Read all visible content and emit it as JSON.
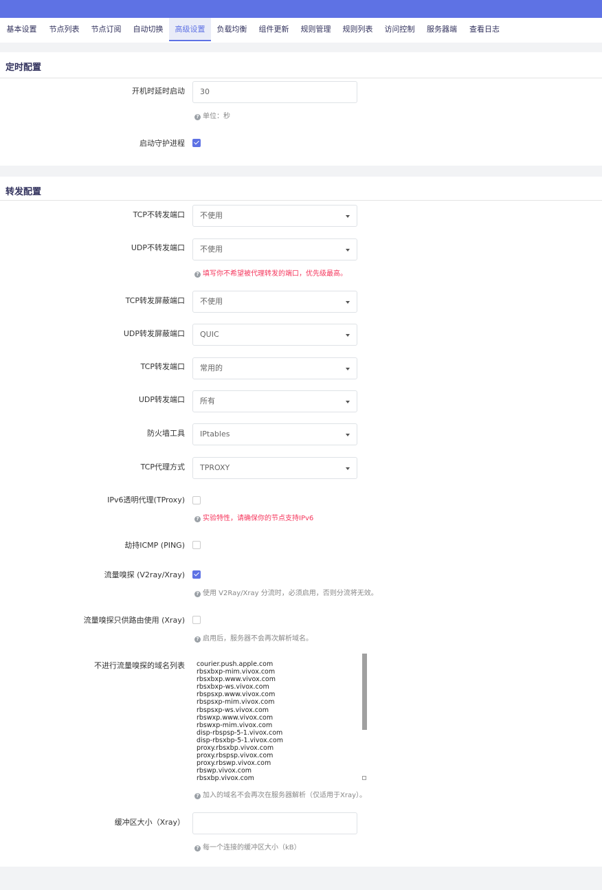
{
  "tabs": [
    {
      "label": "基本设置"
    },
    {
      "label": "节点列表"
    },
    {
      "label": "节点订阅"
    },
    {
      "label": "自动切换"
    },
    {
      "label": "高级设置"
    },
    {
      "label": "负载均衡"
    },
    {
      "label": "组件更新"
    },
    {
      "label": "规则管理"
    },
    {
      "label": "规则列表"
    },
    {
      "label": "访问控制"
    },
    {
      "label": "服务器端"
    },
    {
      "label": "查看日志"
    }
  ],
  "active_tab": "高级设置",
  "timing": {
    "title": "定时配置",
    "boot_delay_label": "开机时延时启动",
    "boot_delay_value": "30",
    "boot_delay_hint": "单位：秒",
    "daemon_label": "启动守护进程",
    "daemon_checked": true
  },
  "forward": {
    "title": "转发配置",
    "tcp_no_redir_label": "TCP不转发端口",
    "tcp_no_redir_value": "不使用",
    "udp_no_redir_label": "UDP不转发端口",
    "udp_no_redir_value": "不使用",
    "no_redir_hint": "填写你不希望被代理转发的端口，优先级最高。",
    "tcp_block_label": "TCP转发屏蔽端口",
    "tcp_block_value": "不使用",
    "udp_block_label": "UDP转发屏蔽端口",
    "udp_block_value": "QUIC",
    "tcp_redir_label": "TCP转发端口",
    "tcp_redir_value": "常用的",
    "udp_redir_label": "UDP转发端口",
    "udp_redir_value": "所有",
    "firewall_label": "防火墙工具",
    "firewall_value": "IPtables",
    "tcp_proxy_label": "TCP代理方式",
    "tcp_proxy_value": "TPROXY",
    "ipv6_label": "IPv6透明代理(TProxy)",
    "ipv6_checked": false,
    "ipv6_hint": "实验特性，请确保你的节点支持IPv6",
    "icmp_label": "劫持ICMP (PING)",
    "icmp_checked": false,
    "sniff_label": "流量嗅探 (V2ray/Xray)",
    "sniff_checked": true,
    "sniff_hint": "使用 V2Ray/Xray 分流时，必须启用，否则分流将无效。",
    "sniff_route_label": "流量嗅探只供路由使用 (Xray)",
    "sniff_route_checked": false,
    "sniff_route_hint": "启用后，服务器不会再次解析域名。",
    "no_sniff_label": "不进行流量嗅探的域名列表",
    "no_sniff_domains": [
      "courier.push.apple.com",
      "rbsxbxp-mim.vivox.com",
      "rbsxbxp.www.vivox.com",
      "rbsxbxp-ws.vivox.com",
      "rbspsxp.www.vivox.com",
      "rbspsxp-mim.vivox.com",
      "rbspsxp-ws.vivox.com",
      "rbswxp.www.vivox.com",
      "rbswxp-mim.vivox.com",
      "disp-rbspsp-5-1.vivox.com",
      "disp-rbsxbp-5-1.vivox.com",
      "proxy.rbsxbp.vivox.com",
      "proxy.rbspsp.vivox.com",
      "proxy.rbswp.vivox.com",
      "rbswp.vivox.com",
      "rbsxbp.vivox.com"
    ],
    "no_sniff_hint": "加入的域名不会再次在服务器解析（仅适用于Xray）。",
    "buffer_label": "缓冲区大小（Xray）",
    "buffer_value": "",
    "buffer_hint": "每一个连接的缓冲区大小（kB）"
  }
}
